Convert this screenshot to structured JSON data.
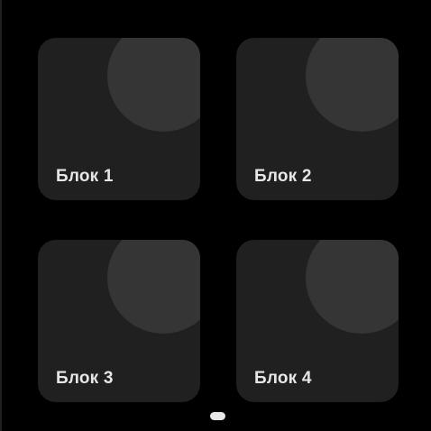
{
  "tiles": [
    {
      "label": "Блок 1"
    },
    {
      "label": "Блок 2"
    },
    {
      "label": "Блок 3"
    },
    {
      "label": "Блок 4"
    }
  ],
  "colors": {
    "background": "#000000",
    "tile": "#202020",
    "decoration": "#353535",
    "label": "#e6e6e6",
    "indicator": "#e8e8e8"
  },
  "pagination": {
    "current_page": 1
  }
}
